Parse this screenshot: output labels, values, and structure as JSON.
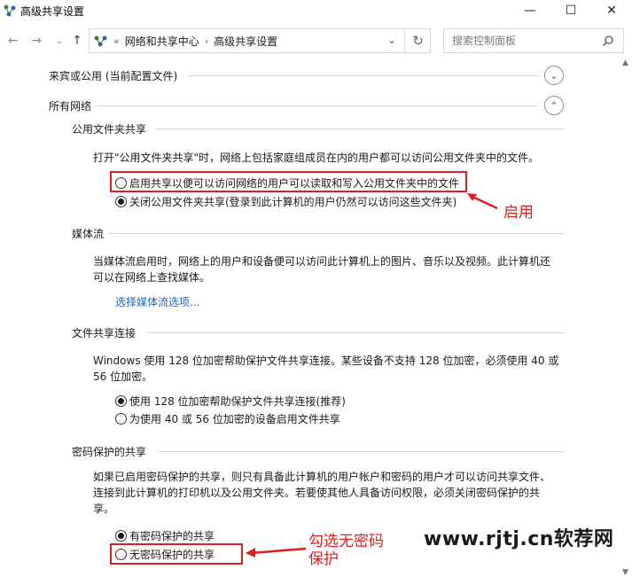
{
  "window": {
    "title": "高级共享设置",
    "minimize": "—",
    "maximize": "☐",
    "close": "✕"
  },
  "nav": {
    "back": "←",
    "forward": "→",
    "recent": "⌄",
    "up": "↑"
  },
  "address": {
    "overflow": "«",
    "crumbs": [
      "网络和共享中心",
      "高级共享设置"
    ],
    "separator": "›",
    "dropdown": "⌄",
    "refresh": "↻"
  },
  "search": {
    "placeholder": "搜索控制面板"
  },
  "sections": {
    "guest": {
      "label": "来宾或公用 (当前配置文件)",
      "chevron": "⌄"
    },
    "all": {
      "label": "所有网络",
      "chevron": "⌃"
    }
  },
  "public_folder": {
    "heading": "公用文件夹共享",
    "description": "打开\"公用文件夹共享\"时，网络上包括家庭组成员在内的用户都可以访问公用文件夹中的文件。",
    "options": [
      {
        "label": "启用共享以便可以访问网络的用户可以读取和写入公用文件夹中的文件",
        "selected": false
      },
      {
        "label": "关闭公用文件夹共享(登录到此计算机的用户仍然可以访问这些文件夹)",
        "selected": true
      }
    ]
  },
  "media": {
    "heading": "媒体流",
    "description_line1": "当媒体流启用时，网络上的用户和设备便可以访问此计算机上的图片、音乐以及视频。此计算机还",
    "description_line2": "可以在网络上查找媒体。",
    "link": "选择媒体流选项..."
  },
  "file_sharing": {
    "heading": "文件共享连接",
    "description_line1": "Windows 使用 128 位加密帮助保护文件共享连接。某些设备不支持 128 位加密，必须使用 40 或",
    "description_line2": "56 位加密。",
    "options": [
      {
        "label": "使用 128 位加密帮助保护文件共享连接(推荐)",
        "selected": true
      },
      {
        "label": "为使用 40 或 56 位加密的设备启用文件共享",
        "selected": false
      }
    ]
  },
  "password": {
    "heading": "密码保护的共享",
    "description_line1": "如果已启用密码保护的共享，则只有具备此计算机的用户帐户和密码的用户才可以访问共享文件、",
    "description_line2": "连接到此计算机的打印机以及公用文件夹。若要使其他人具备访问权限，必须关闭密码保护的共",
    "description_line3": "享。",
    "options": [
      {
        "label": "有密码保护的共享",
        "selected": true
      },
      {
        "label": "无密码保护的共享",
        "selected": false
      }
    ]
  },
  "annotations": {
    "enable": "启用",
    "check_line1": "勾选无密码",
    "check_line2": "保护",
    "watermark": "www.rjtj.cn软荐网",
    "color": "#e01e1e"
  }
}
